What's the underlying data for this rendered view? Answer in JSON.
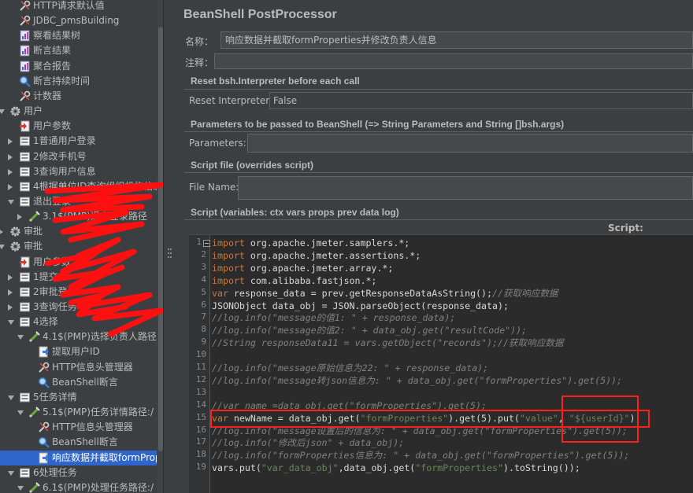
{
  "tree": {
    "items": [
      {
        "label": "HTTP请求默认值",
        "icon": "wrench-icon"
      },
      {
        "label": "JDBC_pmsBuilding",
        "icon": "wrench-icon"
      },
      {
        "label": "察看结果树",
        "icon": "chart-icon"
      },
      {
        "label": "断言结果",
        "icon": "chart-icon"
      },
      {
        "label": "聚合报告",
        "icon": "chart-icon"
      },
      {
        "label": "断言持续时间",
        "icon": "magnifier-icon"
      },
      {
        "label": "计数器",
        "icon": "wrench-icon"
      },
      {
        "label": "用户",
        "icon": "gear-icon"
      },
      {
        "label": "用户参数",
        "icon": "preprocessor-icon"
      },
      {
        "label": "1普通用户登录",
        "icon": "controller-icon"
      },
      {
        "label": "2修改手机号",
        "icon": "controller-icon"
      },
      {
        "label": "3查询用户信息",
        "icon": "controller-icon"
      },
      {
        "label": "4根据单位ID查询组织机构信息",
        "icon": "controller-icon"
      },
      {
        "label": "退出登录",
        "icon": "controller-icon"
      },
      {
        "label": "3.1$(PMP)退出登录路径",
        "icon": "sampler-icon"
      },
      {
        "label": "审批",
        "icon": "gear-icon"
      },
      {
        "label": "审批",
        "icon": "gear-icon"
      },
      {
        "label": "用户参数",
        "icon": "preprocessor-icon"
      },
      {
        "label": "1提交",
        "icon": "controller-icon"
      },
      {
        "label": "2审批登录",
        "icon": "controller-icon"
      },
      {
        "label": "3查询任务",
        "icon": "controller-icon"
      },
      {
        "label": "4选择",
        "icon": "controller-icon"
      },
      {
        "label": "4.1$(PMP)选择负责人路径",
        "icon": "sampler-icon"
      },
      {
        "label": "提取用户ID",
        "icon": "postprocessor-icon"
      },
      {
        "label": "HTTP信息头管理器",
        "icon": "wrench-icon"
      },
      {
        "label": "BeanShell断言",
        "icon": "magnifier-icon"
      },
      {
        "label": "5任务详情",
        "icon": "controller-icon"
      },
      {
        "label": "5.1$(PMP)任务详情路径:/",
        "icon": "sampler-icon"
      },
      {
        "label": "HTTP信息头管理器",
        "icon": "wrench-icon"
      },
      {
        "label": "BeanShell断言",
        "icon": "magnifier-icon"
      },
      {
        "label": "响应数据并截取formProp",
        "icon": "postprocessor-icon"
      },
      {
        "label": "6处理任务",
        "icon": "controller-icon"
      },
      {
        "label": "6.1$(PMP)处理任务路径:/",
        "icon": "sampler-icon"
      }
    ]
  },
  "panel": {
    "title": "BeanShell PostProcessor",
    "name_label": "名称：",
    "name_value": "响应数据并截取formProperties并修改负责人信息",
    "comment_label": "注释：",
    "comment_value": "",
    "reset_section": "Reset bsh.Interpreter before each call",
    "reset_label": "Reset Interpreter:",
    "reset_value": "False",
    "params_section": "Parameters to be passed to BeanShell (=> String Parameters and String []bsh.args)",
    "params_label": "Parameters:",
    "params_value": "",
    "file_section": "Script file (overrides script)",
    "file_label": "File Name:",
    "file_value": "",
    "script_section": "Script (variables: ctx vars props prev data log)",
    "script_label": "Script:"
  },
  "editor": {
    "line_numbers": [
      "1",
      "2",
      "3",
      "4",
      "5",
      "6",
      "7",
      "8",
      "9",
      "10",
      "11",
      "12",
      "13",
      "14",
      "15",
      "16",
      "17",
      "18",
      "19"
    ],
    "lines": [
      [
        [
          "kw",
          "import"
        ],
        [
          "pl",
          " org.apache.jmeter.samplers.*;"
        ]
      ],
      [
        [
          "kw",
          "import"
        ],
        [
          "pl",
          " org.apache.jmeter.assertions.*;"
        ]
      ],
      [
        [
          "kw",
          "import"
        ],
        [
          "pl",
          " org.apache.jmeter.array.*;"
        ]
      ],
      [
        [
          "kw",
          "import"
        ],
        [
          "pl",
          " com.alibaba.fastjson.*;"
        ]
      ],
      [
        [
          "kw",
          "var"
        ],
        [
          "pl",
          " response_data = prev.getResponseDataAsString();"
        ],
        [
          "cmt",
          "//获取响应数据"
        ]
      ],
      [
        [
          "pl",
          "JSONObject data_obj = JSON.parseObject(response_data);"
        ]
      ],
      [
        [
          "cmt",
          "//log.info(\"message的值1: \" + response_data);"
        ]
      ],
      [
        [
          "cmt",
          "//log.info(\"message的值2: \" + data_obj.get(\"resultCode\"));"
        ]
      ],
      [
        [
          "cmt",
          "//String responseData11 = vars.getObject(\"records\");//获取响应数据"
        ]
      ],
      [],
      [
        [
          "cmt",
          "//log.info(\"message原始信息为22: \" + response_data);"
        ]
      ],
      [
        [
          "cmt",
          "//log.info(\"message转json信息为: \" + data_obj.get(\"formProperties\").get(5));"
        ]
      ],
      [],
      [
        [
          "cmt",
          "//var name =data_obj.get(\"formProperties\").get(5);"
        ]
      ],
      [
        [
          "kw",
          "var"
        ],
        [
          "pl",
          " newName = data_obj.get("
        ],
        [
          "str",
          "\"formProperties\""
        ],
        [
          "pl",
          ").get(5).put("
        ],
        [
          "str",
          "\"value\""
        ],
        [
          "pl",
          ", "
        ],
        [
          "str",
          "\"${userId}\""
        ],
        [
          "pl",
          ");"
        ]
      ],
      [
        [
          "cmt",
          "//log.info(\"message设置后的信息为: \" + data_obj.get(\"formProperties\").get(5));"
        ]
      ],
      [
        [
          "cmt",
          "//log.info(\"修改后json\" + data_obj);"
        ]
      ],
      [
        [
          "cmt",
          "//log.info(\"formProperties信息为: \" + data_obj.get(\"formProperties\").get(5));"
        ]
      ],
      [
        [
          "pl",
          "vars.put("
        ],
        [
          "str",
          "\"var_data_obj\""
        ],
        [
          "pl",
          ",data_obj.get("
        ],
        [
          "str",
          "\"formProperties\""
        ],
        [
          "pl",
          ").toString());"
        ]
      ]
    ]
  },
  "colors": {
    "background": "#3c3f41",
    "editor_bg": "#2b2b2b",
    "selection": "#2f65ca",
    "keyword": "#cc7832",
    "string": "#6a8759",
    "comment": "#808080",
    "annotation": "#ff1f1f"
  }
}
